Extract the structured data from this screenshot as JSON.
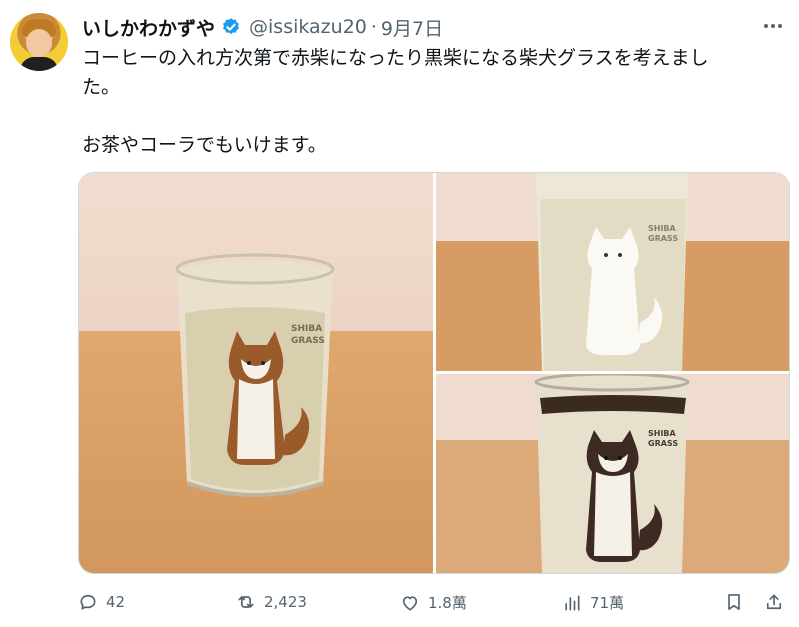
{
  "user": {
    "display_name": "いしかわかずや",
    "handle": "@issikazu20",
    "separator": "·",
    "date": "9月7日"
  },
  "tweet": {
    "line1": "コーヒーの入れ方次第で赤柴になったり黒柴になる柴犬グラスを考えまし",
    "line2": "た。",
    "line3": "お茶やコーラでもいけます。"
  },
  "media": {
    "glass_label_top": "SHIBA",
    "glass_label_bottom": "GRASS",
    "icons": [
      "shiba-glass-brown",
      "shiba-glass-white",
      "shiba-glass-black"
    ]
  },
  "actions": {
    "replies": "42",
    "reposts": "2,423",
    "likes": "1.8萬",
    "views": "71萬"
  },
  "colors": {
    "verified": "#1d9bf0",
    "secondary_text": "#536471"
  }
}
